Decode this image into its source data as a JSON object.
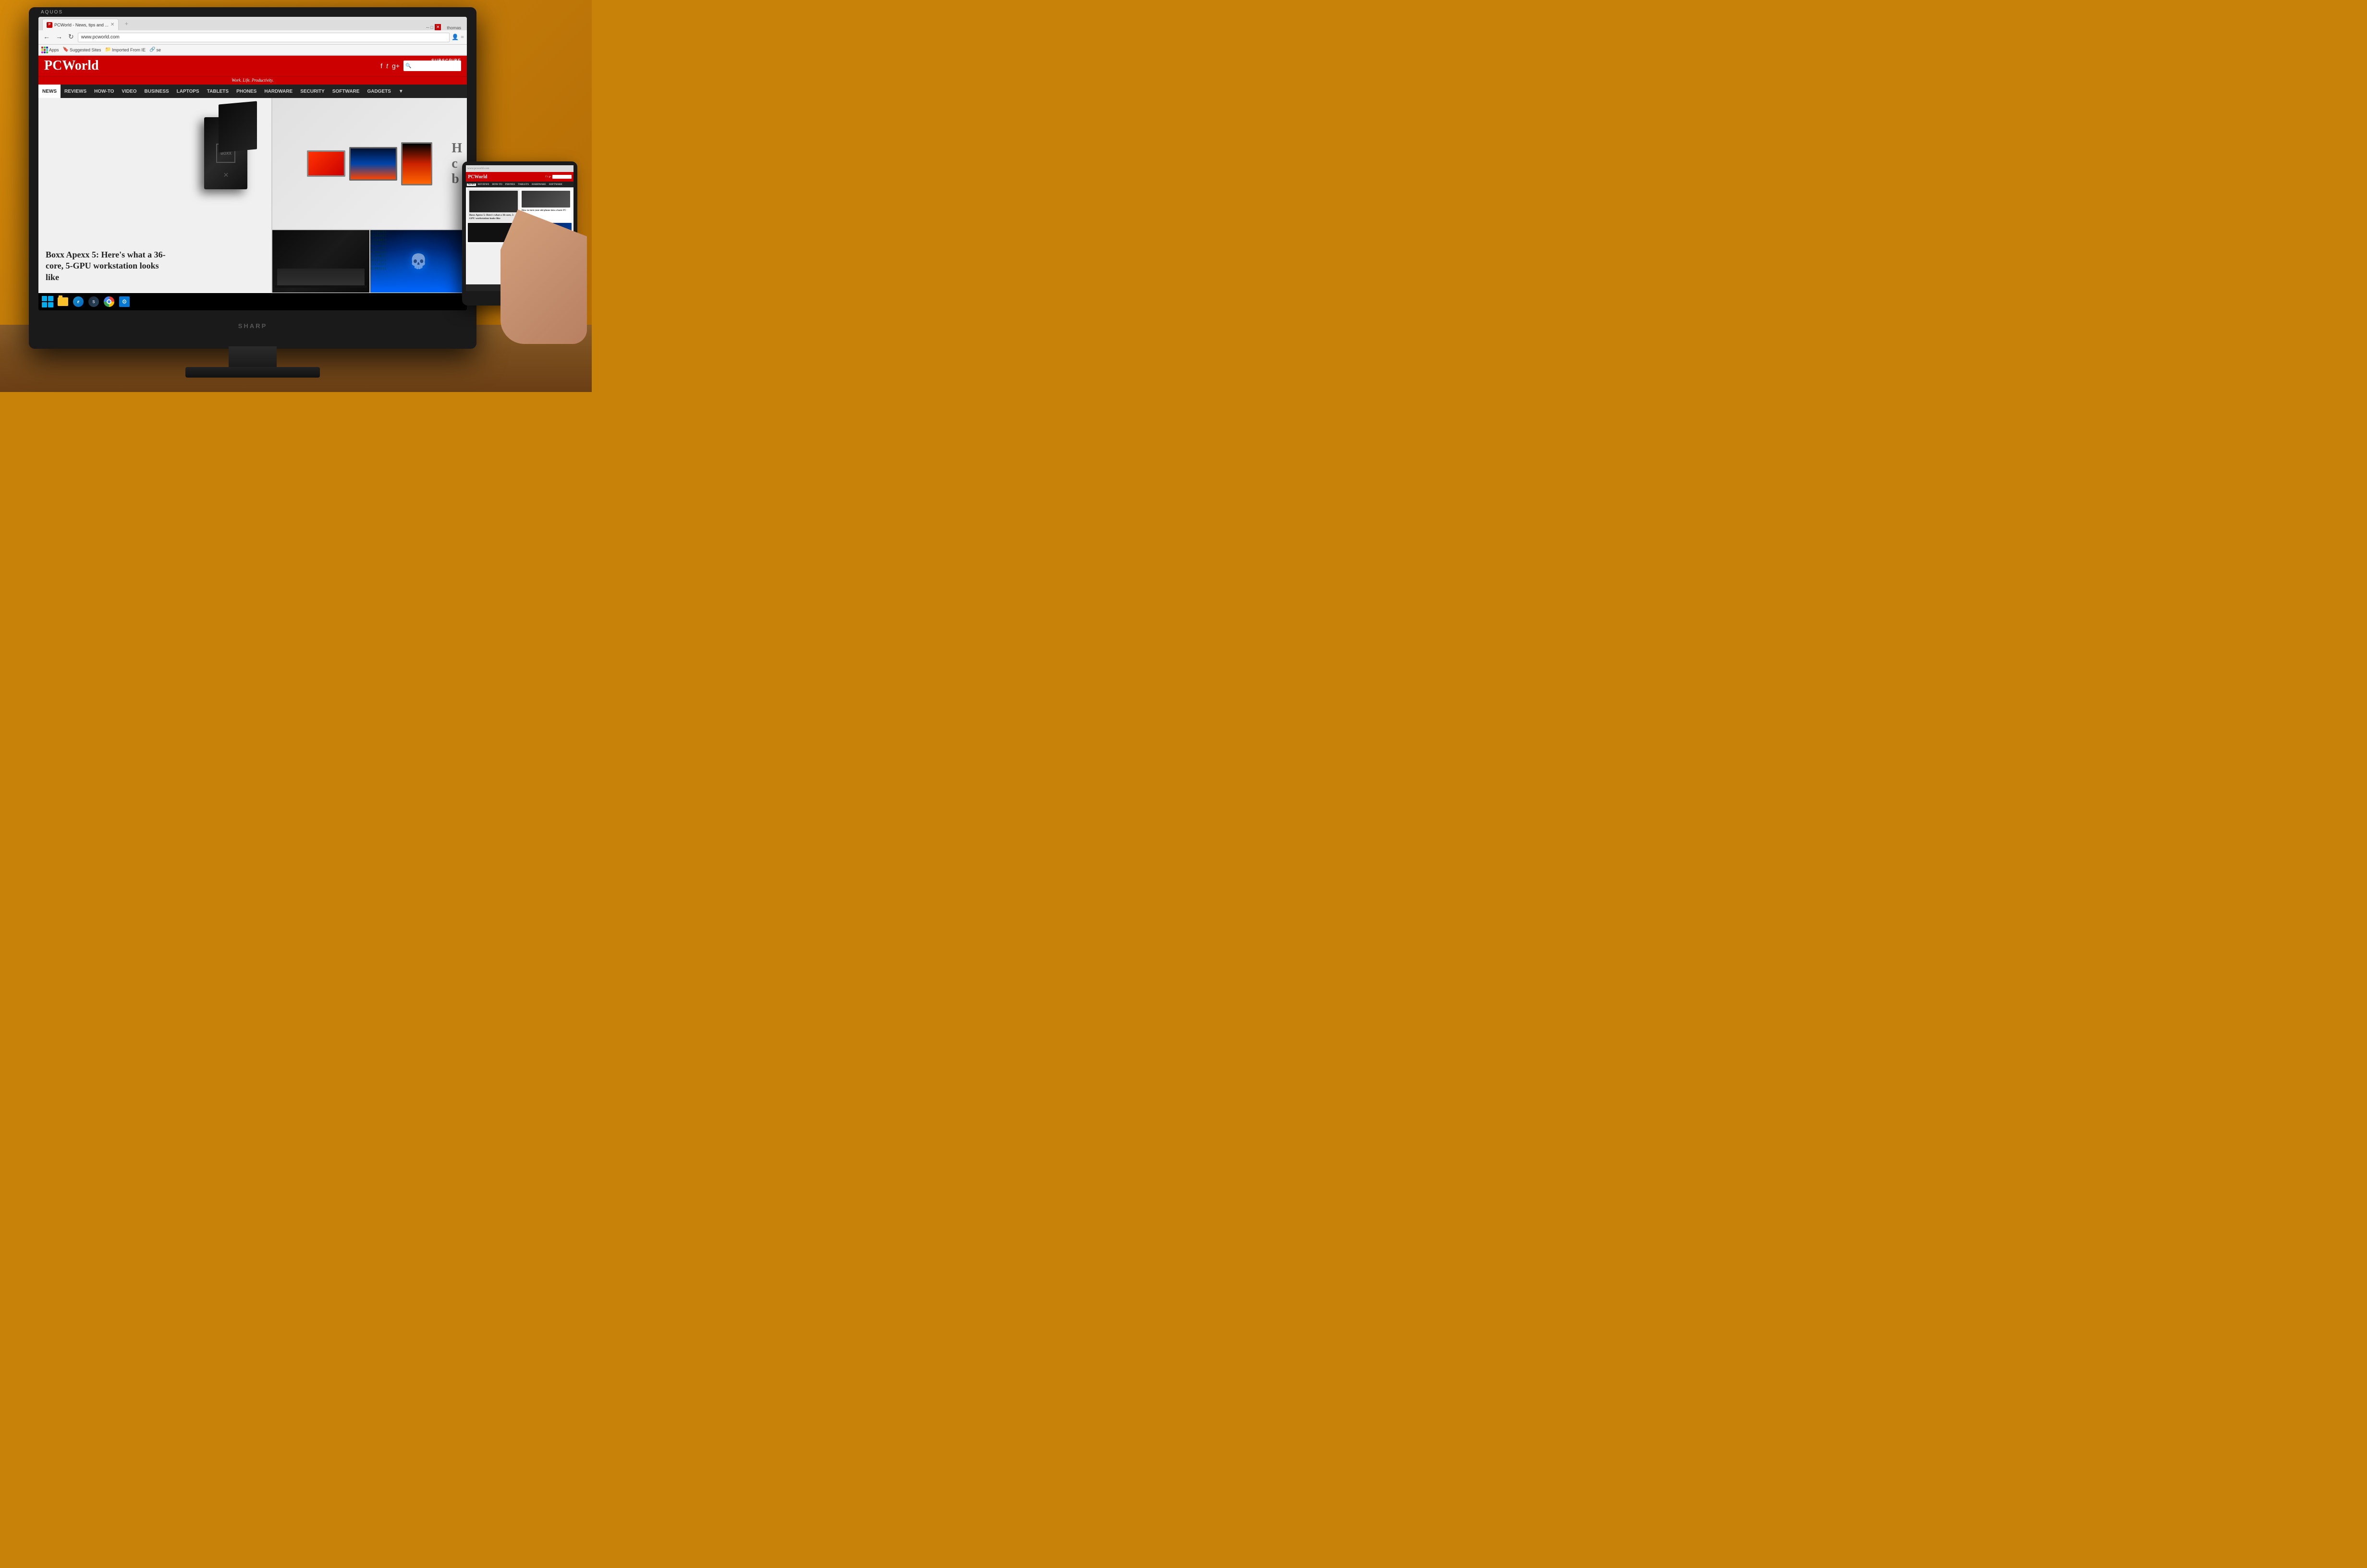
{
  "page": {
    "background": "#c8820a",
    "dimensions": "4928x3264"
  },
  "tv": {
    "brand": "SHARP",
    "model_label": "AQUOS",
    "bezel_color": "#1a1a1a"
  },
  "browser": {
    "tab_title": "PCWorld - News, tips and ...",
    "tab_favicon": "P",
    "url": "www.pcworld.com",
    "user": "thomas",
    "bookmarks": {
      "apps_label": "Apps",
      "suggested_label": "Suggested Sites",
      "imported_label": "Imported From IE",
      "se_label": "se"
    },
    "nav_buttons": {
      "back": "←",
      "forward": "→",
      "refresh": "↻"
    }
  },
  "pcworld": {
    "logo": "PCWorld",
    "tagline": "Work. Life. Productivity.",
    "subscribe": "SUBSCRIBE",
    "nav_items": [
      {
        "label": "NEWS",
        "active": true
      },
      {
        "label": "REVIEWS",
        "active": false
      },
      {
        "label": "HOW-TO",
        "active": false
      },
      {
        "label": "VIDEO",
        "active": false
      },
      {
        "label": "BUSINESS",
        "active": false
      },
      {
        "label": "LAPTOPS",
        "active": false
      },
      {
        "label": "TABLETS",
        "active": false
      },
      {
        "label": "PHONES",
        "active": false
      },
      {
        "label": "HARDWARE",
        "active": false
      },
      {
        "label": "SECURITY",
        "active": false
      },
      {
        "label": "SOFTWARE",
        "active": false
      },
      {
        "label": "GADGETS",
        "active": false
      }
    ],
    "hero_headline": "Boxx Apexx 5: Here's what a 36-core, 5-GPU workstation looks like",
    "social": {
      "facebook": "f",
      "twitter": "t",
      "gplus": "g+"
    }
  },
  "taskbar": {
    "items": [
      {
        "name": "windows-start",
        "label": "⊞"
      },
      {
        "name": "file-explorer",
        "label": "📁"
      },
      {
        "name": "ie",
        "label": "🌐"
      },
      {
        "name": "steam",
        "label": "S"
      },
      {
        "name": "chrome",
        "label": "C"
      },
      {
        "name": "settings",
        "label": "⚙"
      }
    ]
  },
  "tablet": {
    "hero_text": "Boxx Apexx 5: Here's what a 36-core, 5-GPU workstation looks like",
    "article_title": "How to turn your old phone into a basic PC",
    "nav_items": [
      "NEWS",
      "REVIEWS",
      "HOW-TO",
      "PHONES",
      "TABLETS",
      "HARDWARE",
      "SOFTWARE"
    ]
  }
}
